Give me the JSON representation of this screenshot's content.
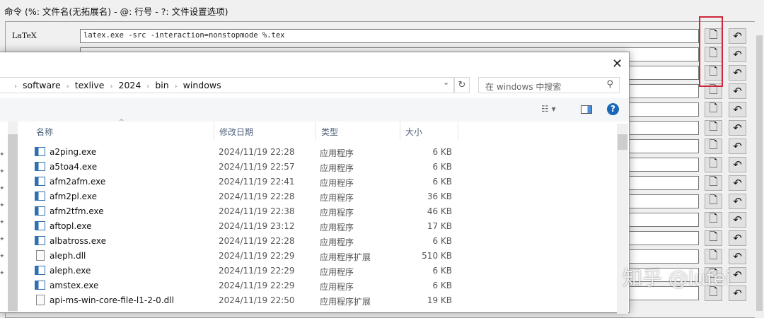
{
  "header": "命令 (%: 文件名(无拓展名) - @: 行号 - ?: 文件设置选项)",
  "commands": [
    {
      "label": "LaTeX",
      "value": "latex.exe -src -interaction=nonstopmode %.tex"
    }
  ],
  "row_buttons": {
    "browse_icon": "file-upload-icon",
    "reset_icon": "undo-icon",
    "rows": 15
  },
  "dialog": {
    "breadcrumb": [
      "software",
      "texlive",
      "2024",
      "bin",
      "windows"
    ],
    "search_placeholder": "在 windows 中搜索",
    "columns": [
      "名称",
      "修改日期",
      "类型",
      "大小"
    ],
    "files": [
      {
        "name": "a2ping.exe",
        "date": "2024/11/19 22:28",
        "type": "应用程序",
        "size": "6 KB",
        "icon": "exe"
      },
      {
        "name": "a5toa4.exe",
        "date": "2024/11/19 22:57",
        "type": "应用程序",
        "size": "6 KB",
        "icon": "exe"
      },
      {
        "name": "afm2afm.exe",
        "date": "2024/11/19 22:41",
        "type": "应用程序",
        "size": "6 KB",
        "icon": "exe"
      },
      {
        "name": "afm2pl.exe",
        "date": "2024/11/19 22:28",
        "type": "应用程序",
        "size": "36 KB",
        "icon": "exe"
      },
      {
        "name": "afm2tfm.exe",
        "date": "2024/11/19 22:38",
        "type": "应用程序",
        "size": "46 KB",
        "icon": "exe"
      },
      {
        "name": "aftopl.exe",
        "date": "2024/11/19 23:12",
        "type": "应用程序",
        "size": "17 KB",
        "icon": "exe"
      },
      {
        "name": "albatross.exe",
        "date": "2024/11/19 22:28",
        "type": "应用程序",
        "size": "6 KB",
        "icon": "exe"
      },
      {
        "name": "aleph.dll",
        "date": "2024/11/19 22:29",
        "type": "应用程序扩展",
        "size": "510 KB",
        "icon": "dll"
      },
      {
        "name": "aleph.exe",
        "date": "2024/11/19 22:29",
        "type": "应用程序",
        "size": "6 KB",
        "icon": "exe"
      },
      {
        "name": "amstex.exe",
        "date": "2024/11/19 22:29",
        "type": "应用程序",
        "size": "6 KB",
        "icon": "exe"
      },
      {
        "name": "api-ms-win-core-file-l1-2-0.dll",
        "date": "2024/11/19 22:50",
        "type": "应用程序扩展",
        "size": "19 KB",
        "icon": "dll"
      }
    ]
  },
  "watermark": "知乎 @lufei"
}
